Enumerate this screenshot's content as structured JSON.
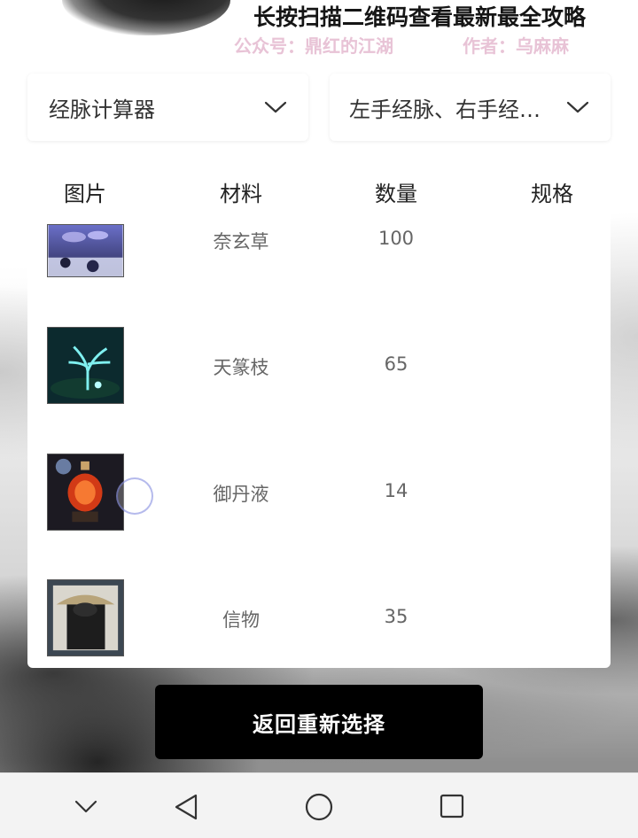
{
  "banner": {
    "title": "长按扫描二维码查看最新最全攻略",
    "official_account": "公众号：鼎红的江湖",
    "author": "作者：乌麻麻"
  },
  "filters": {
    "calculator": "经脉计算器",
    "meridians": "左手经脉、右手经…"
  },
  "table": {
    "headers": [
      "图片",
      "材料",
      "数量",
      "规格"
    ],
    "rows": [
      {
        "name": "奈玄草",
        "qty": "100",
        "spec": ""
      },
      {
        "name": "天篆枝",
        "qty": "65",
        "spec": ""
      },
      {
        "name": "御丹液",
        "qty": "14",
        "spec": ""
      },
      {
        "name": "信物",
        "qty": "35",
        "spec": ""
      }
    ]
  },
  "actions": {
    "back_label": "返回重新选择"
  },
  "system_nav": {
    "icons": [
      "chevron-down-icon",
      "back-triangle-icon",
      "home-circle-icon",
      "recents-square-icon"
    ]
  },
  "colors": {
    "accent_button": "#000000",
    "banner_sub": "#e8c3d6"
  }
}
